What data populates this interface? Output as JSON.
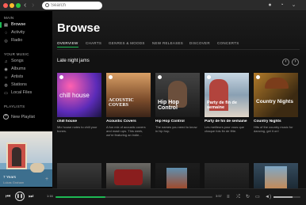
{
  "window": {
    "controls": [
      "close",
      "minimize",
      "maximize"
    ]
  },
  "search": {
    "placeholder": "Search",
    "value": ""
  },
  "sidebar": {
    "main_items": [
      {
        "label": "Browse",
        "icon": "browse-icon",
        "active": true
      },
      {
        "label": "Activity",
        "icon": "activity-icon"
      },
      {
        "label": "Radio",
        "icon": "radio-icon"
      }
    ],
    "library_label": "YOUR MUSIC",
    "library_items": [
      {
        "label": "Songs",
        "icon": "songs-icon"
      },
      {
        "label": "Albums",
        "icon": "albums-icon"
      },
      {
        "label": "Artists",
        "icon": "artists-icon"
      },
      {
        "label": "Stations",
        "icon": "stations-icon"
      },
      {
        "label": "Local Files",
        "icon": "local-files-icon"
      }
    ],
    "playlists_label": "PLAYLISTS",
    "new_playlist_label": "New Playlist"
  },
  "main": {
    "title": "Browse",
    "tabs": [
      {
        "label": "OVERVIEW",
        "active": true
      },
      {
        "label": "CHARTS"
      },
      {
        "label": "GENRES & MOODS"
      },
      {
        "label": "NEW RELEASES"
      },
      {
        "label": "DISCOVER"
      },
      {
        "label": "CONCERTS"
      }
    ],
    "section_title": "Late night jams",
    "cards": [
      {
        "cover_text": "chill house",
        "name": "chill house",
        "desc": "Mix house notes to chill your bones."
      },
      {
        "cover_text": "ACOUSTIC COVERS",
        "name": "Acoustic Covers",
        "desc": "A fun mix of acoustic covers and mash ups. This week, we're featuring an indie..."
      },
      {
        "cover_text": "Hip Hop Control",
        "name": "Hip Hop Control",
        "desc": "The names you need to know in hip hop."
      },
      {
        "cover_text": "Party de fin de semaine",
        "name": "Party de fin de semaine",
        "desc": "Les meilleurs pour vous que chaque fois fin de fête."
      },
      {
        "cover_text": "Country Nights",
        "name": "Country Nights",
        "desc": "Hits of the country music for dancing, get it on!"
      }
    ]
  },
  "now_playing": {
    "title": "7 Years",
    "artist": "Lukas Graham",
    "time_current": "1:16",
    "time_total": "3:57",
    "progress": 0.32,
    "volume": 0.7
  },
  "colors": {
    "accent": "#1db954",
    "background": "#121212",
    "sidebar": "#000000",
    "player": "#181818"
  }
}
